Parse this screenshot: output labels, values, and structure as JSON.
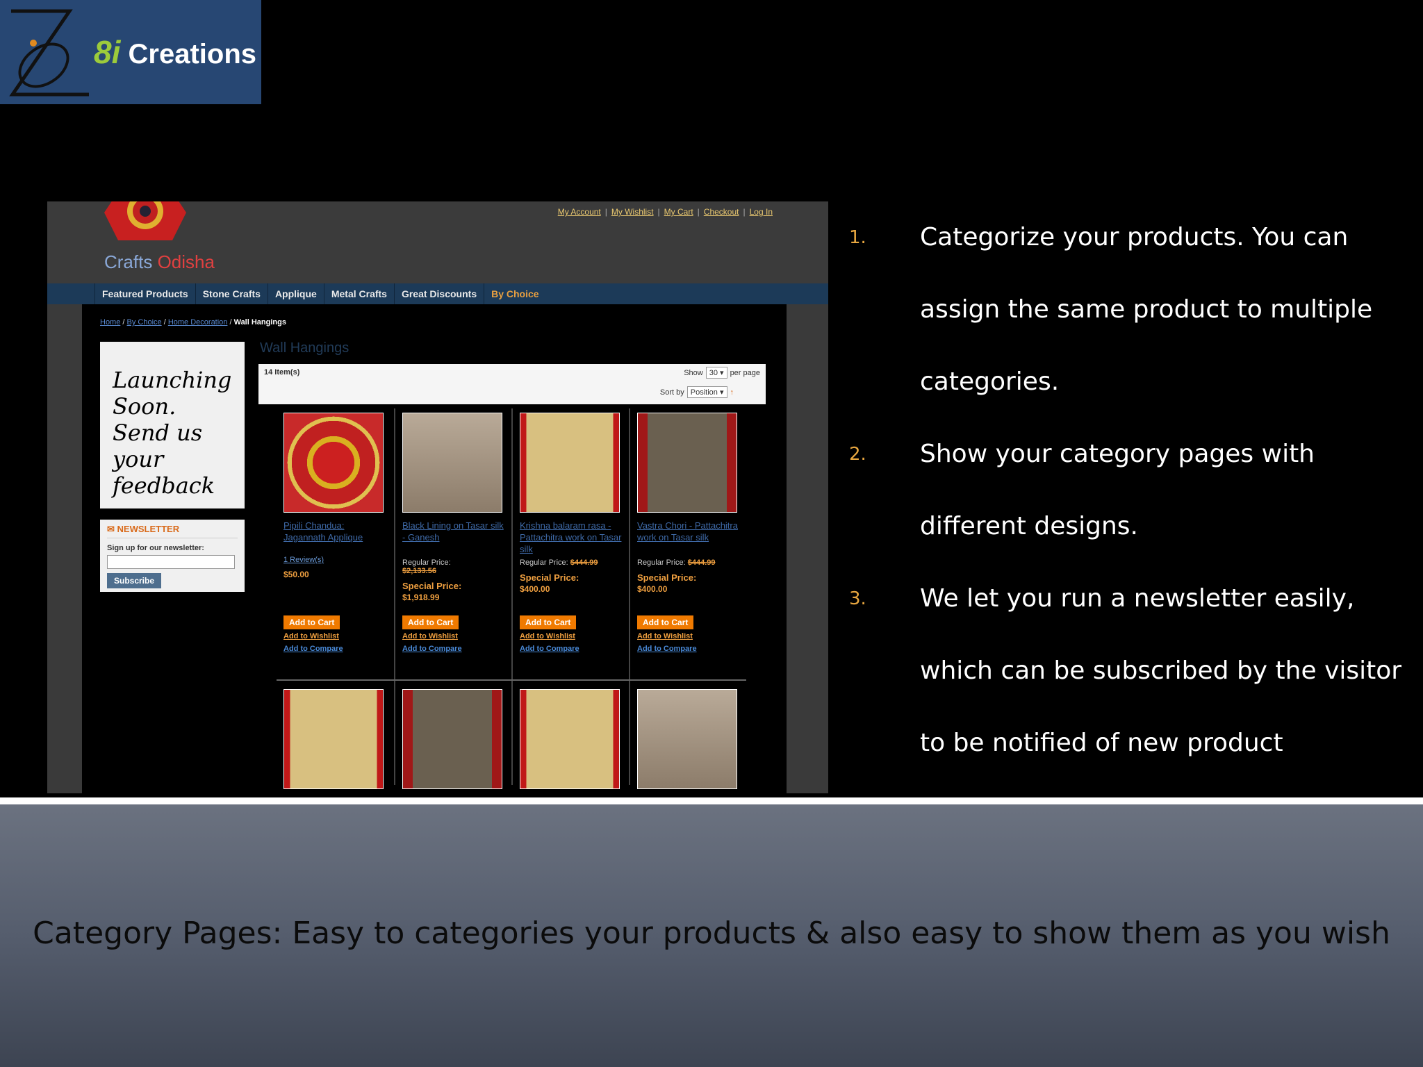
{
  "brand": {
    "num": "8i",
    "word": "Creations"
  },
  "site": {
    "logo_text_a": "Crafts",
    "logo_text_b": "Odisha",
    "toplinks": [
      "My Account",
      "My Wishlist",
      "My Cart",
      "Checkout",
      "Log In"
    ],
    "nav": [
      "Featured Products",
      "Stone Crafts",
      "Applique",
      "Metal Crafts",
      "Great Discounts",
      "By Choice"
    ],
    "breadcrumbs": [
      "Home",
      "By Choice",
      "Home Decoration"
    ],
    "breadcrumb_current": "Wall Hangings",
    "launch_text": "Launching Soon. Send us your feedback",
    "newsletter": {
      "heading": "NEWSLETTER",
      "label": "Sign up for our newsletter:",
      "button": "Subscribe"
    },
    "category_title": "Wall Hangings",
    "toolbar": {
      "count": "14 Item(s)",
      "show": "Show",
      "per_page_value": "30",
      "per_page": "per page",
      "sort_by": "Sort by",
      "sort_value": "Position",
      "sort_arrow": "↑"
    },
    "products": [
      {
        "name": "Pipili Chandua: Jagannath Applique",
        "reviews": "1 Review(s)",
        "price": "$50.00"
      },
      {
        "name": "Black Lining on Tasar silk - Ganesh",
        "regular_label": "Regular Price:",
        "regular_price": "$2,133.56",
        "special_label": "Special Price:",
        "special_price": "$1,918.99"
      },
      {
        "name": "Krishna balaram rasa - Pattachitra work on Tasar silk",
        "regular_label": "Regular Price:",
        "regular_price": "$444.99",
        "special_label": "Special Price:",
        "special_price": "$400.00"
      },
      {
        "name": "Vastra Chori - Pattachitra work on Tasar silk",
        "regular_label": "Regular Price:",
        "regular_price": "$444.99",
        "special_label": "Special Price:",
        "special_price": "$400.00"
      }
    ],
    "add_to_cart": "Add to Cart",
    "add_to_wishlist": "Add to Wishlist",
    "add_to_compare": "Add to Compare"
  },
  "points": [
    {
      "num": "1.",
      "text": "Categorize your products. You can assign the same product to multiple categories."
    },
    {
      "num": "2.",
      "text": "Show your category pages with different designs."
    },
    {
      "num": "3.",
      "text": "We let you run  a newsletter easily, which can be subscribed by the visitor to be notified of new product availability."
    }
  ],
  "footer": {
    "caption": "Category Pages: Easy to categories your products & also easy to show them as you wish"
  }
}
